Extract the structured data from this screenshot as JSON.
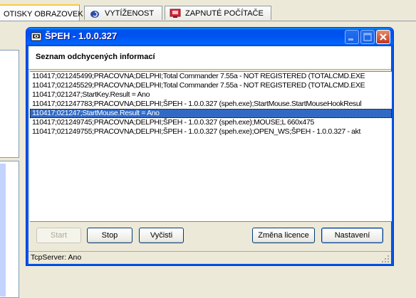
{
  "background_tabs": [
    {
      "label": "OTISKY OBRAZOVEK",
      "icon": "screenshot-icon",
      "active": true
    },
    {
      "label": "VYTÍŽENOST",
      "icon": "snail-icon",
      "active": false
    },
    {
      "label": "ZAPNUTÉ POČÍTAČE",
      "icon": "monitor-icon",
      "active": false
    }
  ],
  "window": {
    "title": "ŠPEH - 1.0.0.327",
    "section_label": "Seznam odchycených informací",
    "log_rows": [
      {
        "text": "110417;021245499;PRACOVNA;DELPHI;Total Commander 7.55a - NOT REGISTERED (TOTALCMD.EXE",
        "selected": false
      },
      {
        "text": "110417;021245529;PRACOVNA;DELPHI;Total Commander 7.55a - NOT REGISTERED (TOTALCMD.EXE",
        "selected": false
      },
      {
        "text": "110417;021247;StartKey.Result = Ano",
        "selected": false
      },
      {
        "text": "110417;021247783;PRACOVNA;DELPHI;ŠPEH - 1.0.0.327 (speh.exe);StartMouse.StartMouseHookResul",
        "selected": false
      },
      {
        "text": "110417;021247;StartMouse.Result = Ano",
        "selected": true
      },
      {
        "text": "110417;021249745;PRACOVNA;DELPHI;ŠPEH - 1.0.0.327 (speh.exe);MOUSE;L 660x475",
        "selected": false
      },
      {
        "text": "110417;021249755;PRACOVNA;DELPHI;ŠPEH - 1.0.0.327 (speh.exe);OPEN_WS;ŠPEH - 1.0.0.327 - akt",
        "selected": false
      }
    ],
    "buttons": {
      "start": "Start",
      "stop": "Stop",
      "clear": "Vyčisti",
      "license": "Změna licence",
      "settings": "Nastavení"
    },
    "status": "TcpServer: Ano"
  }
}
